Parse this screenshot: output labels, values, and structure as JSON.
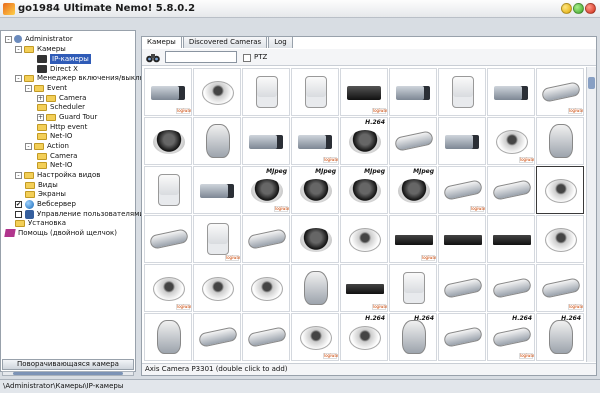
{
  "window": {
    "title": "go1984 Ultimate Nemo! 5.8.0.2"
  },
  "tree": [
    {
      "label": "Administrator",
      "icon": "admin-icon",
      "twisty": "-"
    },
    {
      "label": "Камеры",
      "icon": "folder-icon",
      "twisty": "-"
    },
    {
      "label": "IP-камеры",
      "icon": "camera-icon",
      "twisty": "",
      "selected": true
    },
    {
      "label": "Direct X",
      "icon": "camera-icon",
      "twisty": ""
    },
    {
      "label": "Менеджер включения/выключения",
      "icon": "folder-icon",
      "twisty": "-"
    },
    {
      "label": "Event",
      "icon": "folder-icon",
      "twisty": "-"
    },
    {
      "label": "Camera",
      "icon": "folder-icon",
      "twisty": "+"
    },
    {
      "label": "Scheduler",
      "icon": "folder-icon",
      "twisty": ""
    },
    {
      "label": "Guard Tour",
      "icon": "folder-icon",
      "twisty": "+"
    },
    {
      "label": "Http event",
      "icon": "folder-icon",
      "twisty": ""
    },
    {
      "label": "Net-IO",
      "icon": "folder-icon",
      "twisty": ""
    },
    {
      "label": "Action",
      "icon": "folder-icon",
      "twisty": "-"
    },
    {
      "label": "Camera",
      "icon": "folder-icon",
      "twisty": ""
    },
    {
      "label": "Net-IO",
      "icon": "folder-icon",
      "twisty": ""
    },
    {
      "label": "Настройка видов",
      "icon": "folder-icon",
      "twisty": "-"
    },
    {
      "label": "Виды",
      "icon": "folder-icon",
      "twisty": ""
    },
    {
      "label": "Экраны",
      "icon": "folder-icon",
      "twisty": ""
    },
    {
      "label": "Вебсервер",
      "icon": "globe-icon",
      "twisty": "",
      "checkbox": "checked"
    },
    {
      "label": "Управление пользователями",
      "icon": "users-icon",
      "twisty": "",
      "checkbox": "unchecked"
    },
    {
      "label": "Установка",
      "icon": "folder-icon",
      "twisty": ""
    },
    {
      "label": "Помощь (двойной щелчок)",
      "icon": "help-icon",
      "twisty": ""
    }
  ],
  "left_footer": {
    "label": "Поворачивающаяся камера"
  },
  "tabs": [
    {
      "label": "Камеры",
      "active": true
    },
    {
      "label": "Discovered Cameras",
      "active": false
    },
    {
      "label": "Log",
      "active": false
    }
  ],
  "toolbar": {
    "search_value": "",
    "ptz_label": "PTZ"
  },
  "camera_grid": {
    "badges": [
      "H.264",
      "MJpeg"
    ],
    "watermark": "logiware",
    "rows": [
      [
        "box",
        "dome-white",
        "cube",
        "cube",
        "box-black",
        "box",
        "cube",
        "box",
        "bullet"
      ],
      [
        "dome-black",
        "ptz",
        "box",
        "box",
        "dome-black",
        "bullet",
        "box",
        "dome-white",
        "ptz"
      ],
      [
        "cube",
        "box",
        "dome-black",
        "dome-black",
        "dome-black",
        "dome-black",
        "bullet",
        "bullet",
        "dome-white"
      ],
      [
        "bullet",
        "cube",
        "bullet",
        "dome-black",
        "dome-white",
        "encoder",
        "encoder",
        "encoder",
        "dome-white"
      ],
      [
        "dome-white",
        "dome-white",
        "dome-white",
        "ptz",
        "encoder",
        "cube",
        "bullet",
        "bullet",
        "bullet"
      ],
      [
        "ptz",
        "bullet",
        "bullet",
        "dome-white",
        "dome-white",
        "ptz",
        "bullet",
        "bullet",
        "ptz"
      ]
    ],
    "badge_map": {
      "1-4": "H.264",
      "2-2": "MJpeg",
      "2-3": "MJpeg",
      "2-4": "MJpeg",
      "2-5": "MJpeg",
      "5-4": "H.264",
      "5-5": "H.264",
      "5-7": "H.264",
      "5-8": "H.264"
    },
    "selected_index": "2-8"
  },
  "status": {
    "text": "Axis Camera P3301 (double click to add)"
  },
  "path": {
    "text": "\\Administrator\\Камеры\\IP-камеры"
  }
}
